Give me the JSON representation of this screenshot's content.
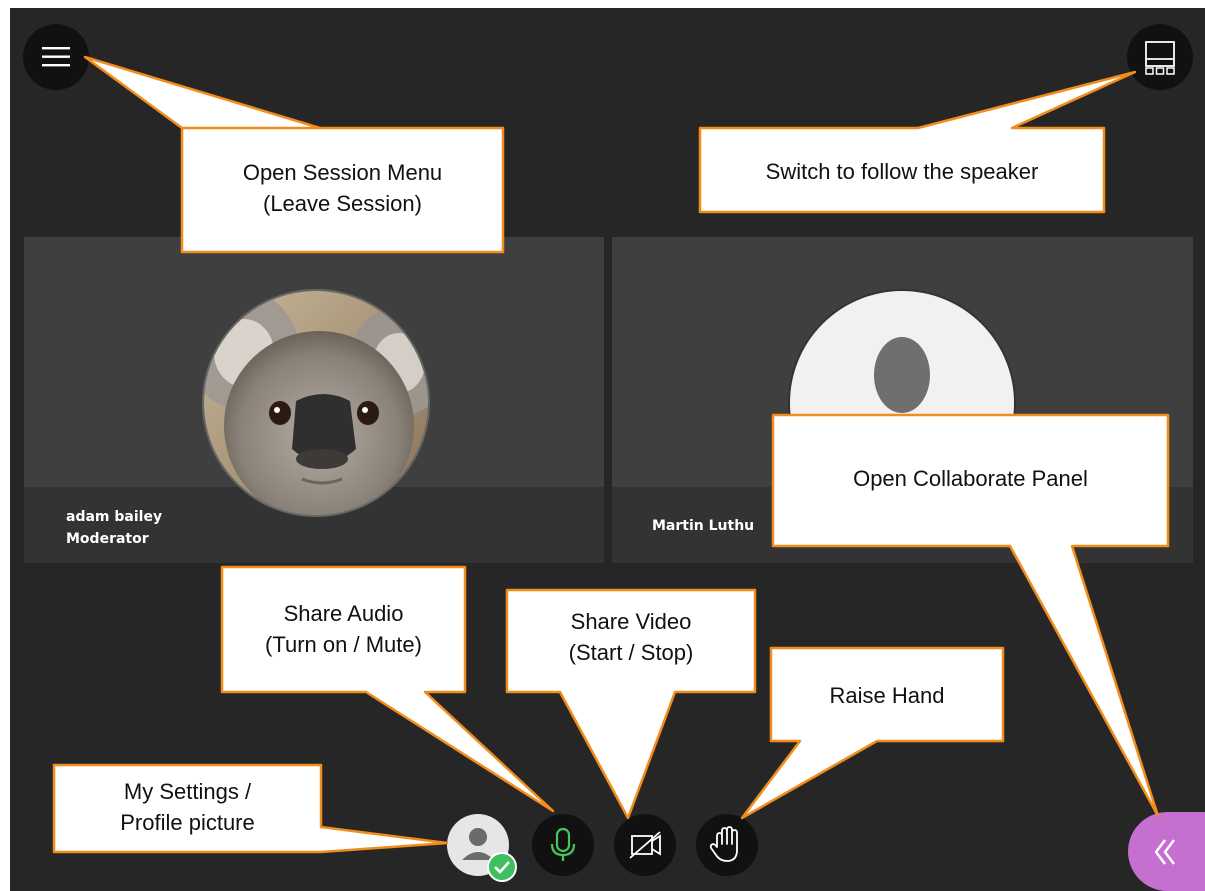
{
  "toolbar": {
    "menu_icon": "hamburger-icon",
    "view_icon": "speaker-view-icon",
    "panel_icon": "chevron-double-left-icon",
    "panel_color": "#c56fd0"
  },
  "participants": [
    {
      "name": "adam bailey",
      "role": "Moderator",
      "avatar": "koala-photo"
    },
    {
      "name": "Martin Luthu",
      "avatar": "default-avatar-icon"
    }
  ],
  "controls": {
    "settings_icon": "profile-avatar-icon",
    "status_icon": "check-icon",
    "status_color": "#3fbf5f",
    "mic_icon": "microphone-icon",
    "mic_color": "#4cc45c",
    "video_icon": "video-off-icon",
    "hand_icon": "raise-hand-icon"
  },
  "callouts": {
    "session_menu": {
      "line1": "Open Session Menu",
      "line2": "(Leave Session)"
    },
    "follow_speaker": {
      "line1": "Switch to follow the speaker"
    },
    "collaborate_panel": {
      "line1": "Open Collaborate Panel"
    },
    "share_audio": {
      "line1": "Share Audio",
      "line2": "(Turn on / Mute)"
    },
    "share_video": {
      "line1": "Share Video",
      "line2": "(Start / Stop)"
    },
    "raise_hand": {
      "line1": "Raise Hand"
    },
    "my_settings": {
      "line1": "My Settings /",
      "line2": "Profile picture"
    }
  },
  "colors": {
    "callout_border": "#f28c1b",
    "callout_fill": "#ffffff",
    "app_background": "#262626",
    "tile_background": "#3f3f3f"
  }
}
